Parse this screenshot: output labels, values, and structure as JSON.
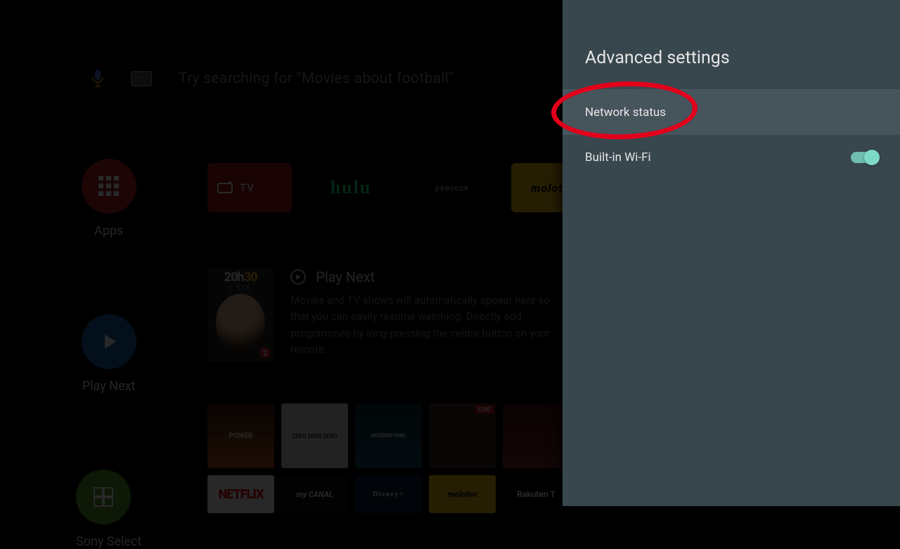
{
  "search": {
    "placeholder": "Try searching for \"Movies about football\""
  },
  "rail": {
    "apps_label": "Apps",
    "play_next_label": "Play Next",
    "sony_label": "Sony Select"
  },
  "apps_row": {
    "tv_label": "TV",
    "hulu_label": "hulu",
    "peacock_label": "peacock",
    "molotov_label": "molotov"
  },
  "play_next": {
    "heading": "Play Next",
    "desc": "Movies and TV shows will automatically appear here so that you can easily resume watching. Directly add programmes by long-pressing the centre button on your remote.",
    "card_time_a": "20h",
    "card_time_b": "30",
    "card_sub": "L'ÉTÉ",
    "card_badge": "2"
  },
  "sony_select": {
    "poster1": "POWER",
    "poster2": "ZERO ZERO ZERO",
    "poster3": "ARTEMIS FOWL",
    "poster4": "",
    "live_badge": "LIVE",
    "poster5": "",
    "netflix": "NETFLIX",
    "mycanal": "my CANAL",
    "disney": "Disney+",
    "molotov": "molotov",
    "rakuten": "Rakuten T"
  },
  "drawer": {
    "title": "Advanced settings",
    "items": [
      {
        "label": "Network status"
      },
      {
        "label": "Built-in Wi-Fi",
        "toggle": true
      }
    ]
  },
  "colors": {
    "drawer_bg": "#38474e",
    "drawer_selected": "#46545b",
    "toggle_on": "#7fd9c8",
    "annotation_red": "#e3001b"
  }
}
